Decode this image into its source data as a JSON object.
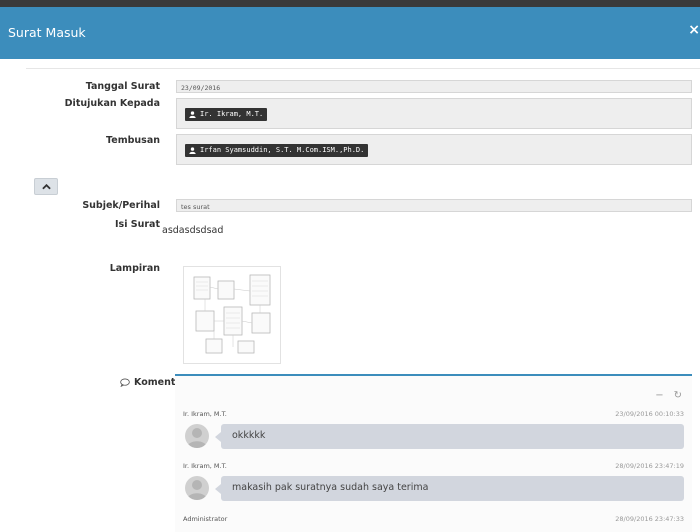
{
  "modal": {
    "title": "Surat Masuk",
    "close_label": "×"
  },
  "form": {
    "tanggal": {
      "label": "Tanggal Surat",
      "value": "23/09/2016"
    },
    "ditujukan": {
      "label": "Ditujukan Kepada",
      "recipient": "Ir. Ikram, M.T."
    },
    "tembusan": {
      "label": "Tembusan",
      "recipient": "Irfan Syamsuddin, S.T. M.Com.ISM.,Ph.D."
    },
    "subjek": {
      "label": "Subjek/Perihal",
      "value": "tes surat"
    },
    "isi": {
      "label": "Isi Surat",
      "value": "asdasdsdsad"
    },
    "lampiran": {
      "label": "Lampiran"
    }
  },
  "komentar": {
    "label": "Komentar",
    "messages": [
      {
        "name": "Ir. Ikram, M.T.",
        "time": "23/09/2016 00:10:33",
        "text": "okkkkk"
      },
      {
        "name": "Ir. Ikram, M.T.",
        "time": "28/09/2016 23:47:19",
        "text": "makasih pak suratnya sudah saya terima"
      },
      {
        "name": "Administrator",
        "time": "28/09/2016 23:47:33",
        "text": ""
      }
    ]
  },
  "colors": {
    "header": "#3c8dbc",
    "chip": "#333333",
    "bubble": "#d2d6de"
  },
  "icons": [
    "close-icon",
    "user-icon",
    "chevron-up-icon",
    "chat-bubble-icon",
    "minus-icon",
    "refresh-icon"
  ]
}
